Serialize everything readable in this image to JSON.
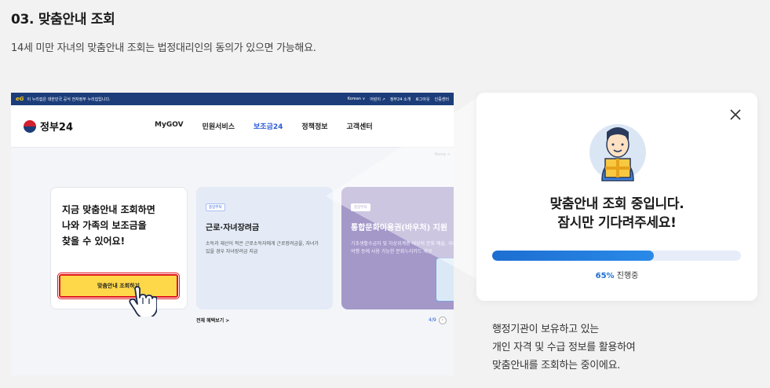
{
  "heading": "03. 맞춤안내 조회",
  "description": "14세 미만 자녀의 맞춤안내 조회는 법정대리인의 동의가 있으면 가능해요.",
  "screenshot": {
    "gov_bar": {
      "logo": "eG",
      "notice": "이 누리집은 대한민국 공식 전자정부 누리집입니다.",
      "links": [
        "Korean ∨",
        "어린이 ↗",
        "정부24 소개",
        "로그아웃",
        "인증센터"
      ]
    },
    "logo_text": "정부24",
    "nav": [
      "MyGOV",
      "민원서비스",
      "보조금24",
      "정책정보",
      "고객센터"
    ],
    "breadcrumb": "Home >",
    "promo": {
      "text": "지금 맞춤안내 조회하면\n나와 가족의 보조금을\n찾을 수 있어요!",
      "button": "맞춤안내 조회하기"
    },
    "card1": {
      "tag": "중앙부처",
      "title": "근로·자녀장려금",
      "text": "소득과 재산이 적은 근로소득자에게 근로장려금을, 자녀가 있을 경우 자녀장려금 지급"
    },
    "card2": {
      "tag": "중앙부처",
      "title": "통합문화이용권(바우처) 지원",
      "text": "기초생활수급자 및 차상위계층 대상의 문화 예술, 국내여행 등에 사용 가능한 문화누리카드 제공"
    },
    "all_benefits": "전체 혜택보기  >",
    "pager": "4/9"
  },
  "modal": {
    "title": "맞춤안내 조회 중입니다.\n잠시만 기다려주세요!",
    "progress": 0.65,
    "progress_pct": "65%",
    "progress_label": "진행중",
    "accent": "#1d6ed1"
  },
  "caption": "행정기관이 보유하고 있는\n개인 자격 및 수급 정보를 활용하여\n맞춤안내를 조회하는 중이에요."
}
